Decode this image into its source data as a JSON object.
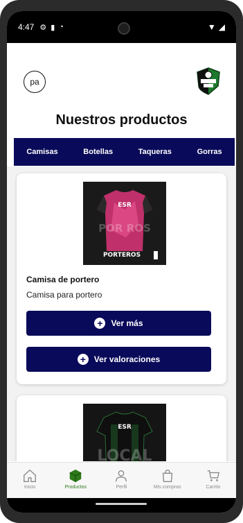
{
  "status_bar": {
    "time": "4:47"
  },
  "header": {
    "avatar_initials": "pa",
    "title": "Nuestros productos"
  },
  "categories": [
    {
      "label": "Camisas"
    },
    {
      "label": "Botellas"
    },
    {
      "label": "Taqueras"
    },
    {
      "label": "Gorras"
    }
  ],
  "products": [
    {
      "image_text": "PORTEROS",
      "name": "Camisa de portero",
      "description": "Camisa para portero",
      "more_label": "Ver más",
      "reviews_label": "Ver valoraciones"
    },
    {
      "image_text": "LOCAL"
    }
  ],
  "bottom_nav": [
    {
      "label": "Inicio",
      "icon": "home-icon"
    },
    {
      "label": "Productos",
      "icon": "box-icon"
    },
    {
      "label": "Perfil",
      "icon": "user-icon"
    },
    {
      "label": "Mis compras",
      "icon": "bag-icon"
    },
    {
      "label": "Carrito",
      "icon": "cart-icon"
    }
  ],
  "colors": {
    "primary": "#0a0a5a",
    "active": "#2d7a1a"
  }
}
